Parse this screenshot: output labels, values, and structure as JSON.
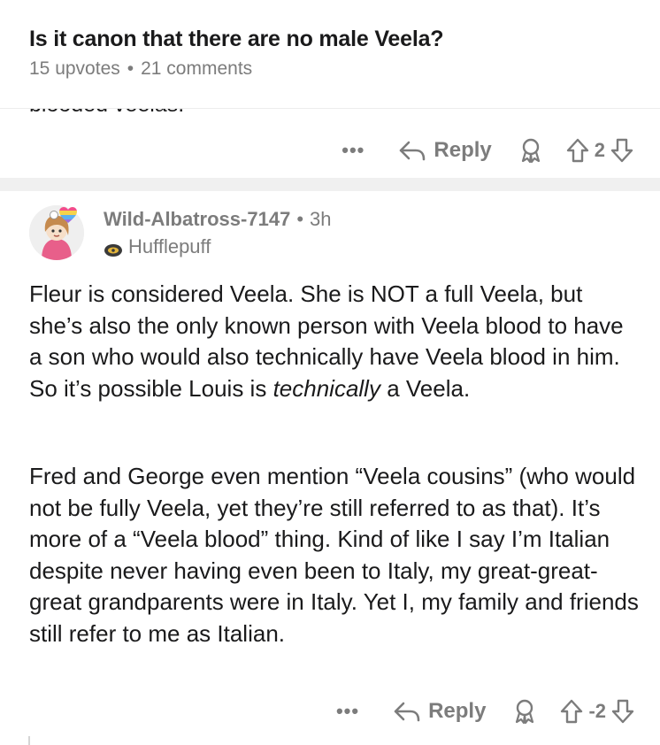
{
  "post": {
    "title": "Is it canon that there are no male Veela?",
    "upvotes": "15 upvotes",
    "separator": "•",
    "comments": "21 comments"
  },
  "prev_comment": {
    "cut_text": "blooded veelas.",
    "more_label": "•••",
    "reply_label": "Reply",
    "score": "2"
  },
  "comment": {
    "author": "Wild-Albatross-7147",
    "separator": "•",
    "age": "3h",
    "flair": "Hufflepuff",
    "p1_before": "Fleur is considered Veela. She is NOT a full Veela, but she’s also the only known person with Veela blood to have a son who would also technically have Veela blood in him. So it’s possible Louis is ",
    "p1_italic": "technically",
    "p1_after": " a Veela.",
    "p2": "Fred and George even mention “Veela cousins” (who would not be fully Veela, yet they’re still referred to as that). It’s more of a “Veela blood” thing. Kind of like I say I’m Italian despite never having even been to Italy, my great-great-great grandparents were in Italy. Yet I, my family and friends still refer to me as Italian.",
    "more_label": "•••",
    "reply_label": "Reply",
    "score": "-2"
  },
  "icons": {
    "reply": "reply-arrow-icon",
    "award": "award-icon",
    "upvote": "upvote-arrow-icon",
    "downvote": "downvote-arrow-icon",
    "avatar": "avatar",
    "flair_badge": "hufflepuff-badge-icon"
  },
  "colors": {
    "meta_gray": "#7c7c7c",
    "text": "#1a1a1b",
    "band": "#f0f0f0"
  }
}
